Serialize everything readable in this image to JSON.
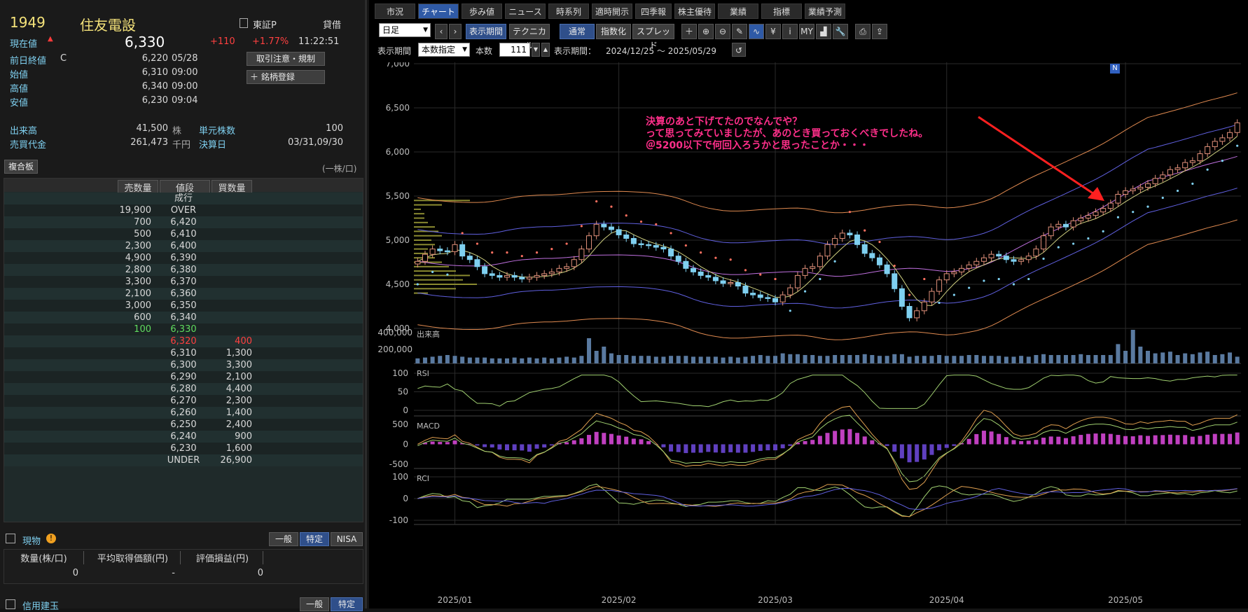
{
  "stock": {
    "code": "1949",
    "name": "住友電設",
    "market": "東証P",
    "margin": "貸借",
    "price_label": "現在値",
    "price": "6,330",
    "change": "+110",
    "change_pct": "+1.77%",
    "time": "11:22:51",
    "rows": [
      {
        "label": "前日終値",
        "flag": "C",
        "value": "6,220",
        "t": "05/28"
      },
      {
        "label": "始値",
        "value": "6,310",
        "t": "09:00"
      },
      {
        "label": "高値",
        "value": "6,340",
        "t": "09:00"
      },
      {
        "label": "安値",
        "value": "6,230",
        "t": "09:04"
      }
    ],
    "btn_order": "取引注意・規制",
    "btn_register": "銘柄登録",
    "volume_label": "出来高",
    "volume": "41,500",
    "volume_unit": "株",
    "unit_label": "単元株数",
    "unit": "100",
    "turnover_label": "売買代金",
    "turnover": "261,473",
    "turnover_unit": "千円",
    "settle_label": "決算日",
    "settle": "03/31,09/30"
  },
  "orderbook": {
    "title": "複合板",
    "unit": "(一株/口)",
    "headers": [
      "売数量",
      "値段",
      "買数量"
    ],
    "rows": [
      [
        "",
        "成行",
        ""
      ],
      [
        "19,900",
        "OVER",
        ""
      ],
      [
        "700",
        "6,420",
        ""
      ],
      [
        "500",
        "6,410",
        ""
      ],
      [
        "2,300",
        "6,400",
        ""
      ],
      [
        "4,900",
        "6,390",
        ""
      ],
      [
        "2,800",
        "6,380",
        ""
      ],
      [
        "3,300",
        "6,370",
        ""
      ],
      [
        "2,100",
        "6,360",
        ""
      ],
      [
        "3,000",
        "6,350",
        ""
      ],
      [
        "600",
        "6,340",
        ""
      ],
      [
        "100",
        "6,330",
        ""
      ],
      [
        "",
        "6,320",
        "400"
      ],
      [
        "",
        "6,310",
        "1,300"
      ],
      [
        "",
        "6,300",
        "3,300"
      ],
      [
        "",
        "6,290",
        "2,100"
      ],
      [
        "",
        "6,280",
        "4,400"
      ],
      [
        "",
        "6,270",
        "2,300"
      ],
      [
        "",
        "6,260",
        "1,400"
      ],
      [
        "",
        "6,250",
        "2,400"
      ],
      [
        "",
        "6,240",
        "900"
      ],
      [
        "",
        "6,230",
        "1,600"
      ],
      [
        "",
        "UNDER",
        "26,900"
      ]
    ]
  },
  "holdings": {
    "title": "現物",
    "tabs": [
      "一般",
      "特定",
      "NISA"
    ],
    "headers": [
      "数量(株/口)",
      "平均取得価額(円)",
      "評価損益(円)"
    ],
    "values": [
      "0",
      "-",
      "0"
    ]
  },
  "credit": {
    "title": "信用建玉",
    "tabs": [
      "一般",
      "特定"
    ]
  },
  "tabs": [
    "市況",
    "チャート",
    "歩み値",
    "ニュース",
    "時系列",
    "適時開示",
    "四季報",
    "株主優待",
    "業績",
    "指標",
    "業績予測"
  ],
  "toolbar": {
    "period": "日足",
    "period_btn": "表示期間",
    "tech_btn": "テクニカル",
    "normal": "通常",
    "index": "指数化",
    "spread": "スプレッド",
    "icons": [
      "plus-icon",
      "zoom-in-icon",
      "zoom-out-icon",
      "pen-icon",
      "wave-icon",
      "yen-icon",
      "info-icon",
      "my-icon",
      "area-icon",
      "wrench-icon",
      "print-icon",
      "export-icon"
    ],
    "icon_glyphs": [
      "＋",
      "⊕",
      "⊖",
      "✎",
      "∿",
      "¥",
      "ⅰ",
      "MY",
      "▟",
      "🔧",
      "⎙",
      "⇪"
    ]
  },
  "range": {
    "label": "表示期間",
    "mode": "本数指定",
    "count_label": "本数",
    "count": "111",
    "period_label": "表示期間：",
    "period": "2024/12/25 ～ 2025/05/29"
  },
  "annotation": [
    "決算のあと下げてたのでなんでや？",
    "って思ってみていましたが、あのとき買っておくべきでしたね。",
    "＠5200以下で何回入ろうかと思ったことか・・・"
  ],
  "marker": "N",
  "chart_data": {
    "type": "candlestick",
    "ylim": [
      4000,
      7000
    ],
    "yticks": [
      "7,000",
      "6,500",
      "6,000",
      "5,500",
      "5,000",
      "4,500",
      "4,000"
    ],
    "xticks": [
      "2025/01",
      "2025/02",
      "2025/03",
      "2025/04",
      "2025/05"
    ],
    "closes": [
      4760,
      4840,
      4900,
      4880,
      4870,
      4950,
      4820,
      4780,
      4700,
      4620,
      4600,
      4580,
      4600,
      4580,
      4560,
      4580,
      4600,
      4620,
      4640,
      4680,
      4700,
      4780,
      4900,
      5050,
      5180,
      5150,
      5120,
      5060,
      5020,
      4960,
      4950,
      4940,
      4920,
      4900,
      4820,
      4760,
      4680,
      4640,
      4600,
      4580,
      4540,
      4510,
      4520,
      4480,
      4400,
      4380,
      4350,
      4340,
      4300,
      4380,
      4460,
      4600,
      4680,
      4700,
      4820,
      4950,
      5020,
      5080,
      5060,
      4950,
      4850,
      4800,
      4720,
      4620,
      4450,
      4250,
      4120,
      4200,
      4300,
      4420,
      4550,
      4620,
      4640,
      4680,
      4720,
      4760,
      4800,
      4840,
      4820,
      4780,
      4760,
      4780,
      4820,
      4900,
      5050,
      5150,
      5180,
      5150,
      5220,
      5250,
      5280,
      5320,
      5360,
      5420,
      5520,
      5560,
      5580,
      5600,
      5640,
      5700,
      5740,
      5800,
      5820,
      5880,
      5900,
      5980,
      6060,
      6120,
      6160,
      6220,
      6330
    ],
    "volume": {
      "ylim": [
        0,
        400000
      ],
      "ticks": [
        "400,000",
        "200,000"
      ]
    },
    "rsi": {
      "ticks": [
        "100",
        "50",
        "0"
      ]
    },
    "macd": {
      "ticks": [
        "500",
        "0",
        "-500"
      ]
    },
    "rci": {
      "ticks": [
        "100",
        "0",
        "-100"
      ]
    },
    "volume_values": [
      60,
      70,
      80,
      90,
      100,
      90,
      80,
      70,
      70,
      70,
      60,
      60,
      60,
      70,
      60,
      70,
      60,
      70,
      60,
      70,
      80,
      70,
      90,
      300,
      150,
      200,
      120,
      100,
      100,
      90,
      90,
      90,
      80,
      80,
      90,
      90,
      90,
      80,
      80,
      80,
      80,
      70,
      80,
      70,
      80,
      90,
      100,
      90,
      90,
      120,
      110,
      110,
      100,
      100,
      90,
      90,
      100,
      100,
      100,
      100,
      110,
      100,
      90,
      90,
      110,
      110,
      80,
      90,
      90,
      90,
      100,
      90,
      90,
      90,
      100,
      100,
      90,
      90,
      90,
      80,
      80,
      90,
      80,
      100,
      110,
      100,
      100,
      100,
      100,
      110,
      100,
      100,
      100,
      100,
      230,
      150,
      400,
      200,
      150,
      120,
      130,
      140,
      100,
      120,
      110,
      130,
      140,
      100,
      110,
      130,
      80
    ]
  }
}
